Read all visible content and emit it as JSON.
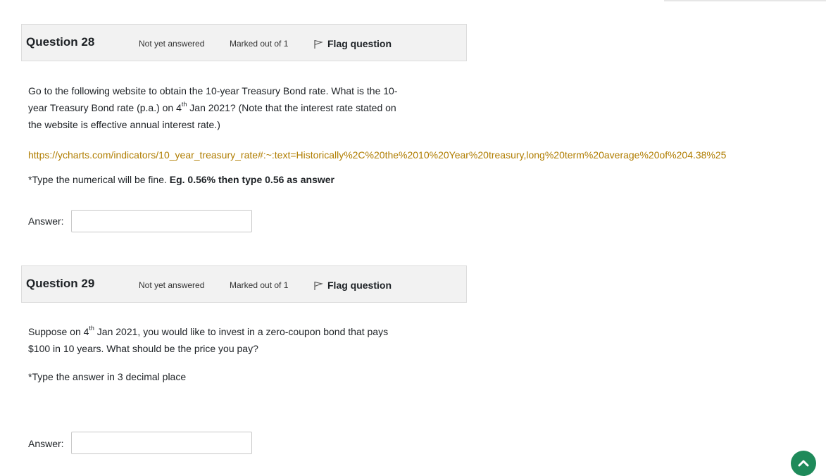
{
  "questions": [
    {
      "title": "Question 28",
      "status": "Not yet answered",
      "marks": "Marked out of 1",
      "flag_label": "Flag question",
      "text_line1": "Go to the following website to obtain the 10-year Treasury Bond rate. What is the 10-",
      "text_line2_a": "year Treasury Bond rate (p.a.) on 4",
      "text_line2_sup": "th",
      "text_line2_b": " Jan 2021? (Note that the interest rate stated on",
      "text_line3": "the website is effective annual interest rate.)",
      "link": "https://ycharts.com/indicators/10_year_treasury_rate#:~:text=Historically%2C%20the%2010%20Year%20treasury,long%20term%20average%20of%204.38%25",
      "instruction_a": "*Type the numerical will be fine. ",
      "instruction_b": "Eg. 0.56% then type 0.56 as answer",
      "answer_label": "Answer:",
      "answer_value": ""
    },
    {
      "title": "Question 29",
      "status": "Not yet answered",
      "marks": "Marked out of 1",
      "flag_label": "Flag question",
      "text_line1_a": "Suppose on 4",
      "text_line1_sup": "th",
      "text_line1_b": " Jan 2021, you would like to invest in a zero-coupon bond that pays",
      "text_line2": "$100 in 10 years. What should be the price you pay?",
      "instruction": "*Type the answer in 3 decimal place",
      "answer_label": "Answer:",
      "answer_value": ""
    }
  ],
  "icons": {
    "flag": "flag-icon",
    "scroll_top": "chevron-up-icon"
  },
  "colors": {
    "link": "#b07d00",
    "header_bg": "#f2f2f2",
    "scroll_button": "#1e8a5a"
  }
}
